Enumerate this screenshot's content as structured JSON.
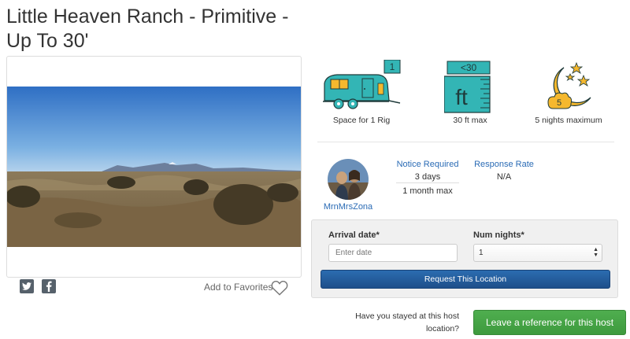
{
  "listing": {
    "title": "Little Heaven Ranch - Primitive - Up To 30'"
  },
  "photo": {
    "description": "desert-landscape-photo"
  },
  "actions": {
    "favorites_label": "Add to Favorites"
  },
  "features": [
    {
      "icon": "rv-trailer-icon",
      "badge": "1",
      "label": "Space for 1 Rig"
    },
    {
      "icon": "length-ft-icon",
      "badge": "<30",
      "icon_text": "ft",
      "label": "30 ft max"
    },
    {
      "icon": "moon-stars-icon",
      "badge": "5",
      "label": "5 nights maximum"
    }
  ],
  "host": {
    "name": "MrnMrsZona",
    "notice_heading": "Notice Required",
    "notice_value": "3 days",
    "advance_value": "1 month max",
    "response_heading": "Response Rate",
    "response_value": "N/A"
  },
  "booking": {
    "arrival_label": "Arrival date*",
    "arrival_placeholder": "Enter date",
    "nights_label": "Num nights*",
    "nights_value": "1",
    "request_button": "Request This Location"
  },
  "reference": {
    "question": "Have you stayed at this host location?",
    "button": "Leave a reference for this host"
  },
  "colors": {
    "accent_teal": "#33b5b5",
    "link_blue": "#2a6bb5",
    "primary_button": "#2b6cb0",
    "success_button": "#46a446",
    "moon_yellow": "#f5b82e"
  }
}
